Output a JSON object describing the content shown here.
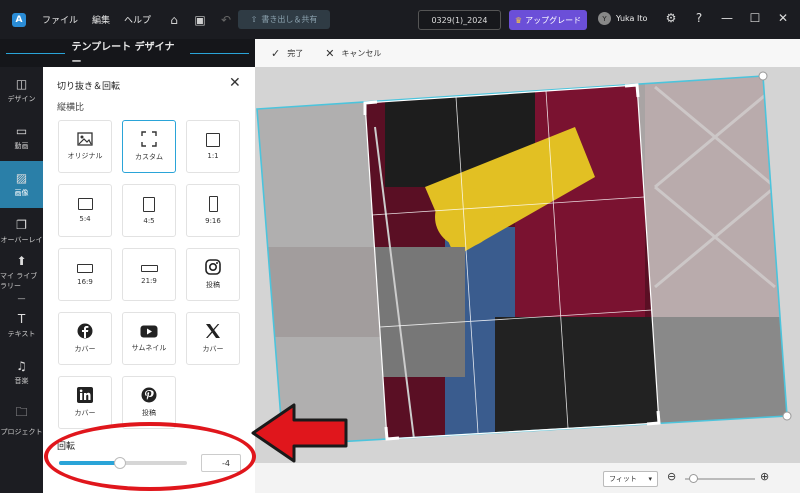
{
  "titlebar": {
    "menu": [
      "ファイル",
      "編集",
      "ヘルプ"
    ],
    "export_label": "書き出し＆共有",
    "project_name": "0329(1)_2024",
    "upgrade_label": "アップグレード",
    "user_initial": "Y",
    "user_name": "Yuka Ito"
  },
  "designer": {
    "title": "テンプレート デザイナー"
  },
  "leftnav": [
    {
      "label": "デザイン",
      "icon": "design-icon"
    },
    {
      "label": "動画",
      "icon": "video-icon"
    },
    {
      "label": "画像",
      "icon": "image-icon",
      "active": true
    },
    {
      "label": "オーバーレイ",
      "icon": "overlay-icon"
    },
    {
      "label": "マイ ライブラリー",
      "icon": "library-icon"
    },
    {
      "label": "テキスト",
      "icon": "text-icon"
    },
    {
      "label": "音楽",
      "icon": "music-icon"
    },
    {
      "label": "プロジェクト",
      "icon": "project-icon"
    }
  ],
  "crop_panel": {
    "title": "切り抜き＆回転",
    "aspect_label": "縦横比",
    "ratios": [
      {
        "label": "オリジナル",
        "icon": "original-icon"
      },
      {
        "label": "カスタム",
        "icon": "custom-crop-icon",
        "selected": true
      },
      {
        "label": "1:1",
        "icon": "square-icon"
      },
      {
        "label": "5:4",
        "icon": "ratio-5-4-icon"
      },
      {
        "label": "4:5",
        "icon": "ratio-4-5-icon"
      },
      {
        "label": "9:16",
        "icon": "ratio-9-16-icon"
      },
      {
        "label": "16:9",
        "icon": "ratio-16-9-icon"
      },
      {
        "label": "21:9",
        "icon": "ratio-21-9-icon"
      },
      {
        "label": "投稿",
        "icon": "instagram-icon"
      },
      {
        "label": "カバー",
        "icon": "facebook-icon"
      },
      {
        "label": "サムネイル",
        "icon": "youtube-icon"
      },
      {
        "label": "カバー",
        "icon": "x-icon"
      },
      {
        "label": "カバー",
        "icon": "linkedin-icon"
      },
      {
        "label": "投稿",
        "icon": "pinterest-icon"
      }
    ],
    "rotation_label": "回転",
    "rotation_value": "-4",
    "rotation_slider_fraction": 0.48
  },
  "edit_toolbar": {
    "done_label": "完了",
    "cancel_label": "キャンセル"
  },
  "bottombar": {
    "fit_label": "フィット"
  },
  "colors": {
    "accent": "#2aa4d8",
    "upgrade": "#6b4fd8",
    "annotation_red": "#e0161c"
  }
}
